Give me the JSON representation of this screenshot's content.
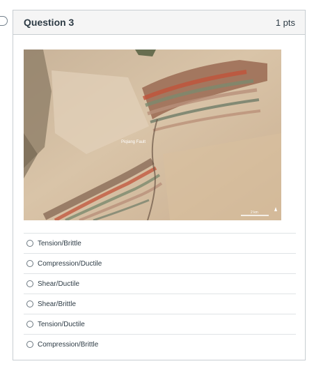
{
  "question": {
    "title": "Question 3",
    "points": "1 pts",
    "image": {
      "fault_label": "Piqiang Fault",
      "scale_text": "2 km"
    },
    "answers": [
      {
        "label": "Tension/Brittle",
        "selected": false
      },
      {
        "label": "Compression/Ductile",
        "selected": false
      },
      {
        "label": "Shear/Ductile",
        "selected": false
      },
      {
        "label": "Shear/Brittle",
        "selected": false
      },
      {
        "label": "Tension/Ductile",
        "selected": false
      },
      {
        "label": "Compression/Brittle",
        "selected": false
      }
    ]
  },
  "colors": {
    "header_bg": "#f5f5f5",
    "border": "#c7cdd1",
    "text": "#2d3b45"
  }
}
